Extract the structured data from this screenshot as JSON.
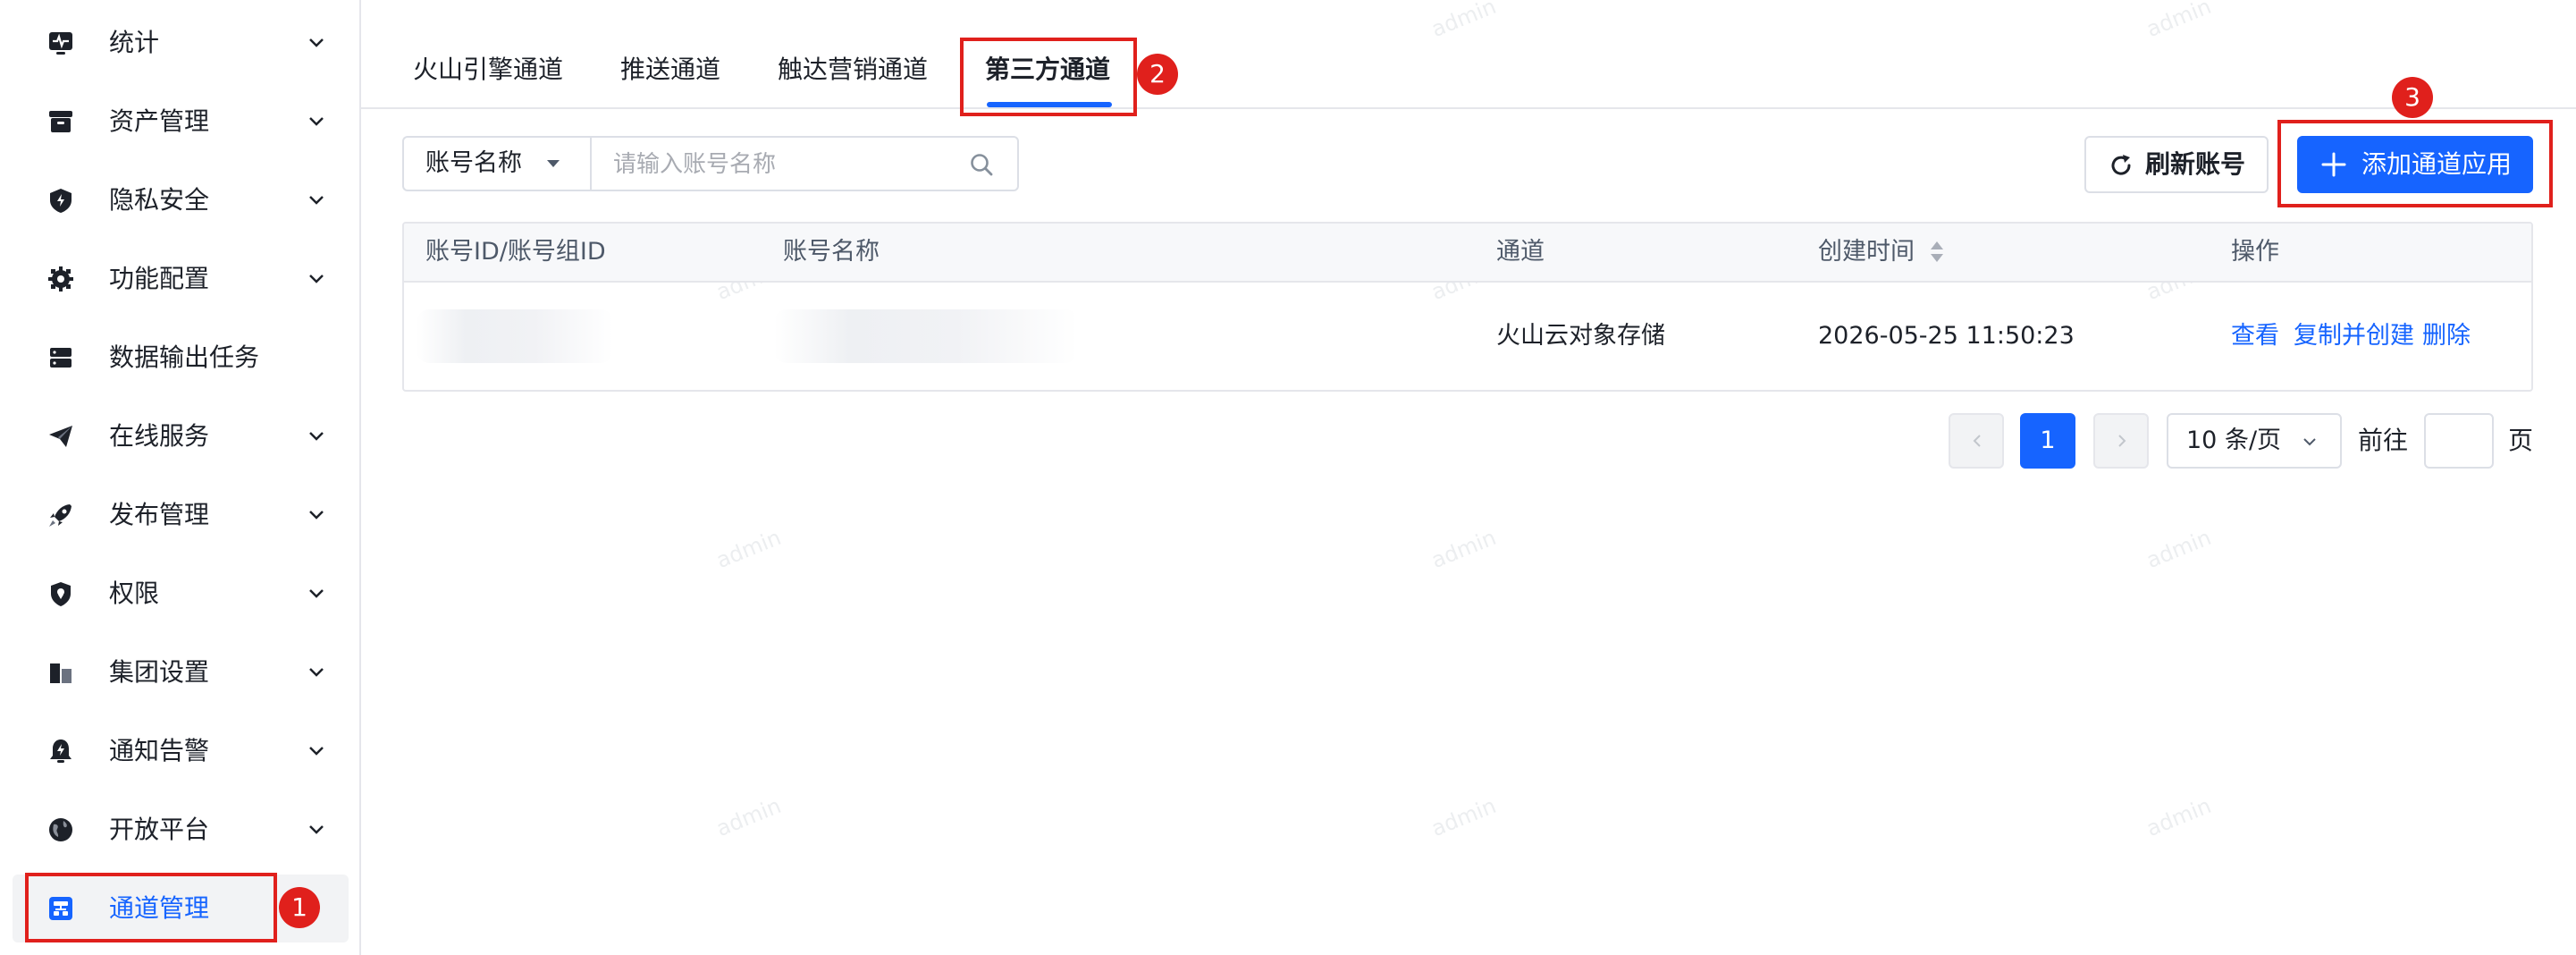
{
  "watermark": "admin",
  "colors": {
    "primary": "#1664ff",
    "annotation": "#e0201c",
    "text": "#1d2129",
    "border": "#e5e6eb"
  },
  "sidebar": {
    "items": [
      {
        "label": "统计",
        "icon": "pulse-monitor-icon",
        "has_children": true
      },
      {
        "label": "资产管理",
        "icon": "archive-box-icon",
        "has_children": true
      },
      {
        "label": "隐私安全",
        "icon": "shield-bolt-icon",
        "has_children": true
      },
      {
        "label": "功能配置",
        "icon": "gear-icon",
        "has_children": true
      },
      {
        "label": "数据输出任务",
        "icon": "server-icon",
        "has_children": false
      },
      {
        "label": "在线服务",
        "icon": "paper-plane-icon",
        "has_children": true
      },
      {
        "label": "发布管理",
        "icon": "rocket-icon",
        "has_children": true
      },
      {
        "label": "权限",
        "icon": "location-shield-icon",
        "has_children": true
      },
      {
        "label": "集团设置",
        "icon": "buildings-icon",
        "has_children": true
      },
      {
        "label": "通知告警",
        "icon": "bell-bolt-icon",
        "has_children": true
      },
      {
        "label": "开放平台",
        "icon": "globe-icon",
        "has_children": true
      },
      {
        "label": "通道管理",
        "icon": "channel-icon",
        "has_children": false,
        "active": true
      }
    ]
  },
  "tabs": [
    {
      "label": "火山引擎通道"
    },
    {
      "label": "推送通道"
    },
    {
      "label": "触达营销通道"
    },
    {
      "label": "第三方通道",
      "active": true
    }
  ],
  "toolbar": {
    "filter_field": "账号名称",
    "search_placeholder": "请输入账号名称",
    "search_value": "",
    "refresh_label": "刷新账号",
    "add_label": "添加通道应用"
  },
  "table": {
    "columns": [
      "账号ID/账号组ID",
      "账号名称",
      "通道",
      "创建时间",
      "操作"
    ],
    "rows": [
      {
        "account_id": "",
        "account_name": "",
        "channel": "火山云对象存储",
        "created_at": "2026-05-25 11:50:23",
        "actions": [
          "查看",
          "复制并创建",
          "删除"
        ]
      }
    ]
  },
  "pagination": {
    "current_page": "1",
    "page_size": "10 条/页",
    "goto_label": "前往",
    "goto_value": "",
    "page_suffix": "页"
  },
  "annotations": [
    "1",
    "2",
    "3"
  ]
}
